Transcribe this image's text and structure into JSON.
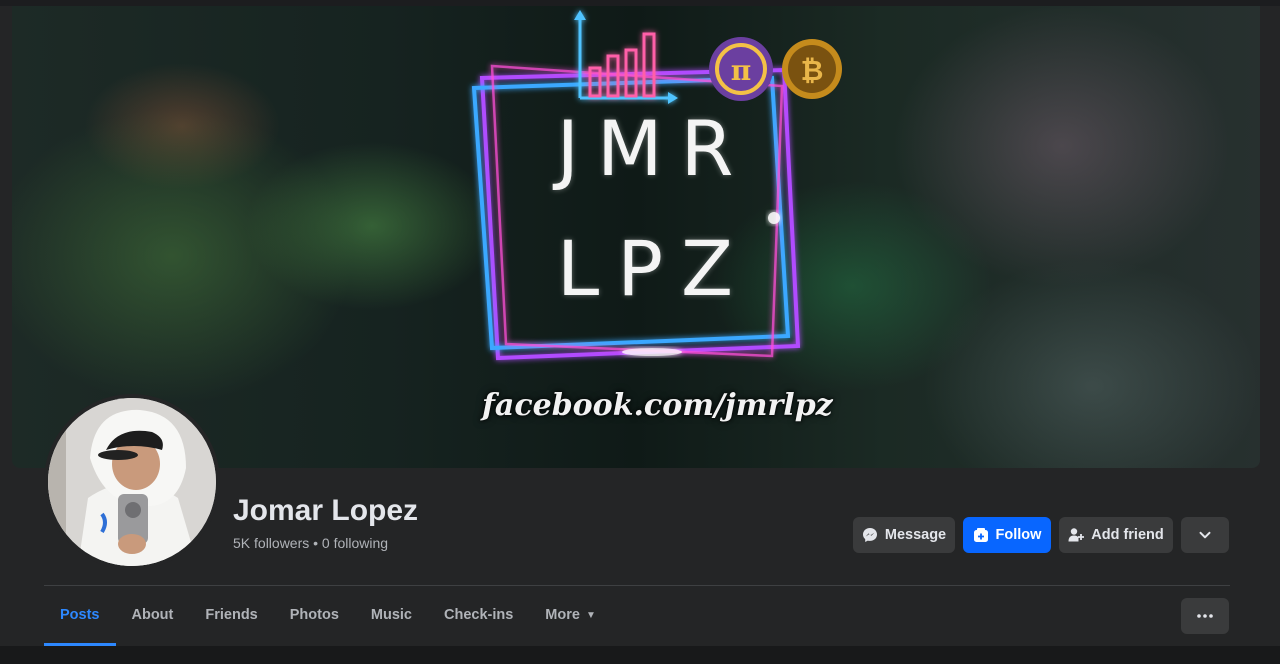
{
  "cover": {
    "title_line1": "JMR",
    "title_line2": "LPZ",
    "url_text": "facebook.com/jmrlpz",
    "icons": [
      "bar-chart-icon",
      "pi-coin-icon",
      "bitcoin-icon"
    ],
    "coin_symbols": {
      "pi": "π",
      "bitcoin": "₿"
    }
  },
  "profile": {
    "name": "Jomar Lopez",
    "stats": "5K followers • 0 following"
  },
  "actions": {
    "message": "Message",
    "follow": "Follow",
    "add_friend": "Add friend"
  },
  "tabs": [
    {
      "label": "Posts",
      "active": true
    },
    {
      "label": "About"
    },
    {
      "label": "Friends"
    },
    {
      "label": "Photos"
    },
    {
      "label": "Music"
    },
    {
      "label": "Check-ins"
    },
    {
      "label": "More",
      "has_caret": true
    }
  ],
  "colors": {
    "accent": "#2d88ff",
    "follow_button": "#0866ff",
    "button_gray": "#3a3b3c",
    "panel": "#242526"
  }
}
